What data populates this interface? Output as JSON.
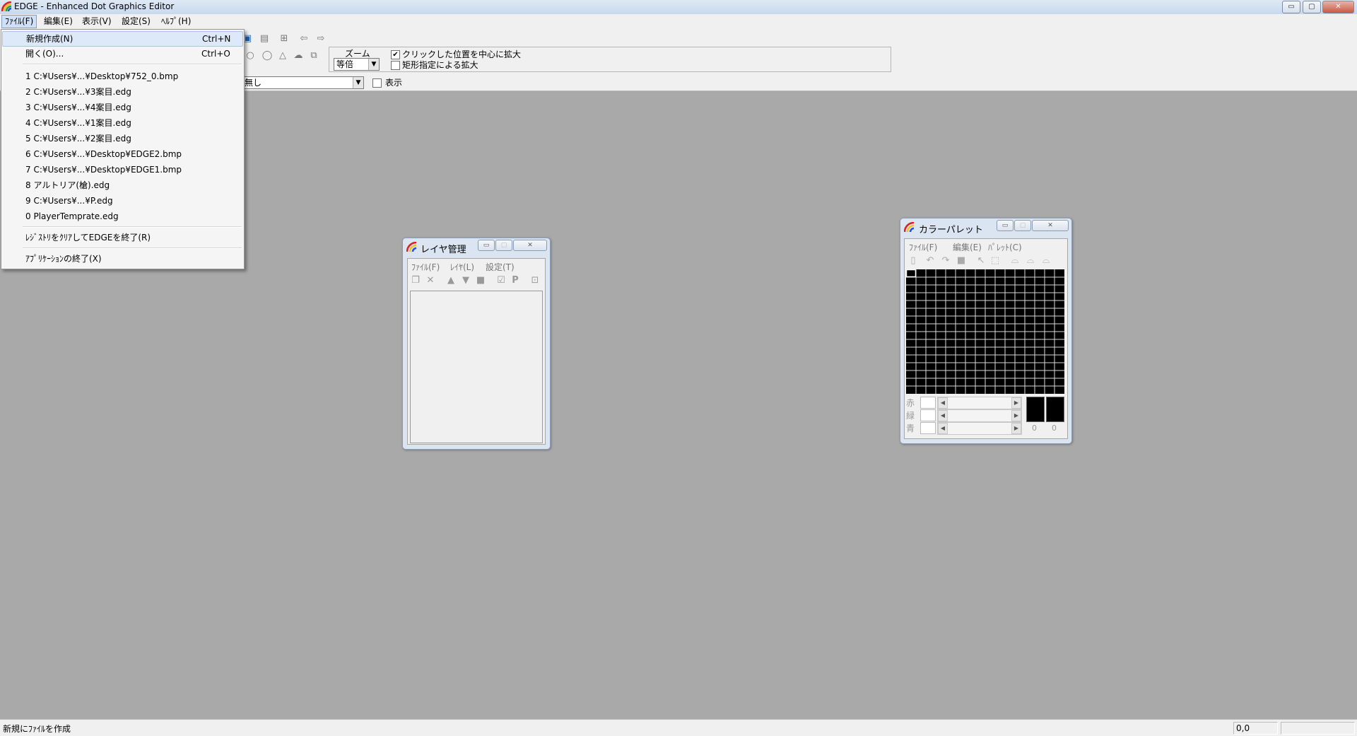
{
  "app": {
    "title": "EDGE - Enhanced Dot Graphics Editor",
    "caption_buttons": [
      "▭",
      "▢",
      "✕"
    ]
  },
  "menubar": {
    "items": [
      "ﾌｧｲﾙ(F)",
      "編集(E)",
      "表示(V)",
      "設定(S)",
      "ﾍﾙﾌﾟ(H)"
    ]
  },
  "toolbar": {
    "zoom_label": "ズーム",
    "zoom_value": "等倍",
    "click_center_label": "クリックした位置を中心に拡大",
    "click_center_checked": true,
    "rect_zoom_label": "矩形指定による拡大",
    "rect_zoom_checked": false,
    "grid_combo_value": "無し",
    "show_label": "表示",
    "show_checked": false
  },
  "file_menu": {
    "new": {
      "label": "新規作成(N)",
      "shortcut": "Ctrl+N"
    },
    "open": {
      "label": "開く(O)...",
      "shortcut": "Ctrl+O"
    },
    "recent": [
      "1 C:¥Users¥...¥Desktop¥752_0.bmp",
      "2 C:¥Users¥...¥3案目.edg",
      "3 C:¥Users¥...¥4案目.edg",
      "4 C:¥Users¥...¥1案目.edg",
      "5 C:¥Users¥...¥2案目.edg",
      "6 C:¥Users¥...¥Desktop¥EDGE2.bmp",
      "7 C:¥Users¥...¥Desktop¥EDGE1.bmp",
      "8 アルトリア(槍).edg",
      "9 C:¥Users¥...¥P.edg",
      "0 PlayerTemprate.edg"
    ],
    "clear_registry": "ﾚｼﾞｽﾄﾘをｸﾘｱしてEDGEを終了(R)",
    "exit": "ｱﾌﾟﾘｹｰｼｮﾝの終了(X)"
  },
  "layer_window": {
    "title": "レイヤ管理",
    "menu": [
      "ﾌｧｲﾙ(F)",
      "ﾚｲﾔ(L)",
      "設定(T)"
    ]
  },
  "palette_window": {
    "title": "カラーパレット",
    "menu": [
      "ﾌｧｲﾙ(F)",
      "編集(E)",
      "ﾊﾟﾚｯﾄ(C)"
    ],
    "channel_labels": [
      "赤",
      "緑",
      "青"
    ],
    "index_values": [
      "0",
      "0"
    ]
  },
  "status": {
    "message": "新規にﾌｧｲﾙを作成",
    "coords": "0,0"
  },
  "colors": {
    "desktop_bg": "#a9a9a9",
    "menu_highlight": "#dde9f8",
    "palette_cells": "#000000"
  }
}
